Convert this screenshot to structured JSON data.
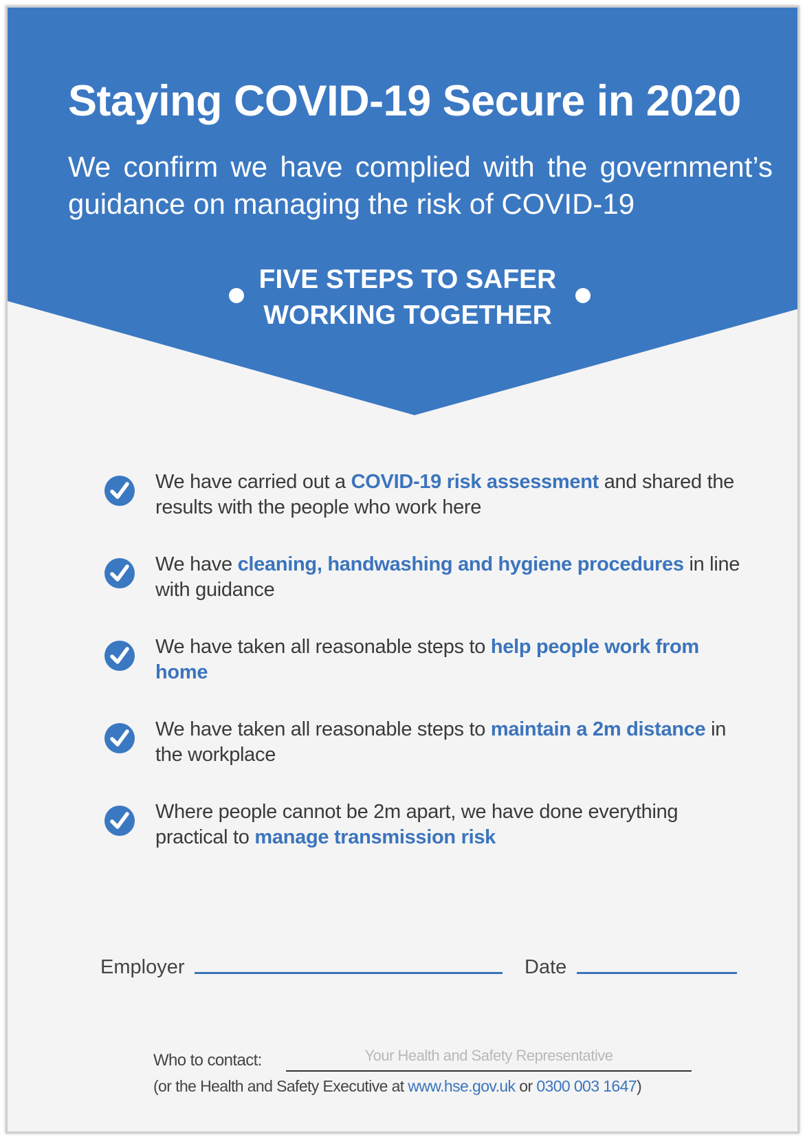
{
  "colors": {
    "brand_blue": "#3b78c2",
    "highlight_blue": "#3b74bd",
    "background": "#f4f4f4",
    "text": "#3a3a3a"
  },
  "header": {
    "title": "Staying COVID-19 Secure in 2020",
    "subtitle": "We confirm we have complied with the government’s guidance on managing the risk of COVID-19",
    "steps_heading_line1": "FIVE STEPS TO SAFER",
    "steps_heading_line2": "WORKING TOGETHER"
  },
  "steps": [
    {
      "icon": "check-circle-icon",
      "before": "We have carried out a ",
      "highlight": "COVID-19 risk assessment",
      "after": " and shared the results with the people who work here"
    },
    {
      "icon": "check-circle-icon",
      "before": "We have ",
      "highlight": "cleaning, handwashing and hygiene procedures",
      "after": " in line with guidance"
    },
    {
      "icon": "check-circle-icon",
      "before": "We have taken all reasonable steps to ",
      "highlight": "help people work from home",
      "after": ""
    },
    {
      "icon": "check-circle-icon",
      "before": "We have taken all reasonable steps to ",
      "highlight": "maintain a 2m distance",
      "after": " in the workplace"
    },
    {
      "icon": "check-circle-icon",
      "before": "Where people cannot be 2m apart, we have done everything practical to ",
      "highlight": "manage transmission risk",
      "after": ""
    }
  ],
  "signature": {
    "employer_label": "Employer",
    "date_label": "Date"
  },
  "contact": {
    "label": "Who to contact:",
    "placeholder": "Your Health and Safety Representative",
    "footnote_before": "(or the Health and Safety Executive at ",
    "website": "www.hse.gov.uk",
    "footnote_mid": " or ",
    "phone": "0300 003 1647",
    "footnote_after": ")"
  }
}
